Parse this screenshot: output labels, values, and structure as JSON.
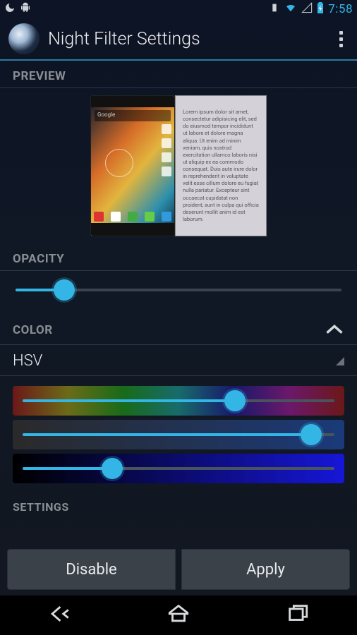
{
  "status": {
    "time": "7:58"
  },
  "header": {
    "title": "Night Filter Settings"
  },
  "sections": {
    "preview": {
      "label": "PREVIEW"
    },
    "opacity": {
      "label": "OPACITY",
      "value": 15
    },
    "color": {
      "label": "COLOR"
    },
    "settings": {
      "label": "SETTINGS"
    }
  },
  "preview_text": "Lorem ipsum dolor sit amet, consectetur adipisicing elit, sed do eiusmod tempor incididunt ut labore et dolore magna aliqua. Ut enim ad minim veniam, quis nostrud exercitation ullamco laboris nisi ut aliquip ex ea commodo consequat. Duis aute irure dolor in reprehenderit in voluptate velit esse cillum dolore eu fugiat nulla pariatur. Excepteur sint occaecat cupidatat non proident, sunt in culpa qui officia deserunt mollit anim id est laborum.",
  "preview_search": "Google",
  "color_mode": {
    "selected": "HSV"
  },
  "hsv": {
    "hue": 67,
    "sat": 90,
    "val": 30
  },
  "buttons": {
    "disable": "Disable",
    "apply": "Apply"
  }
}
